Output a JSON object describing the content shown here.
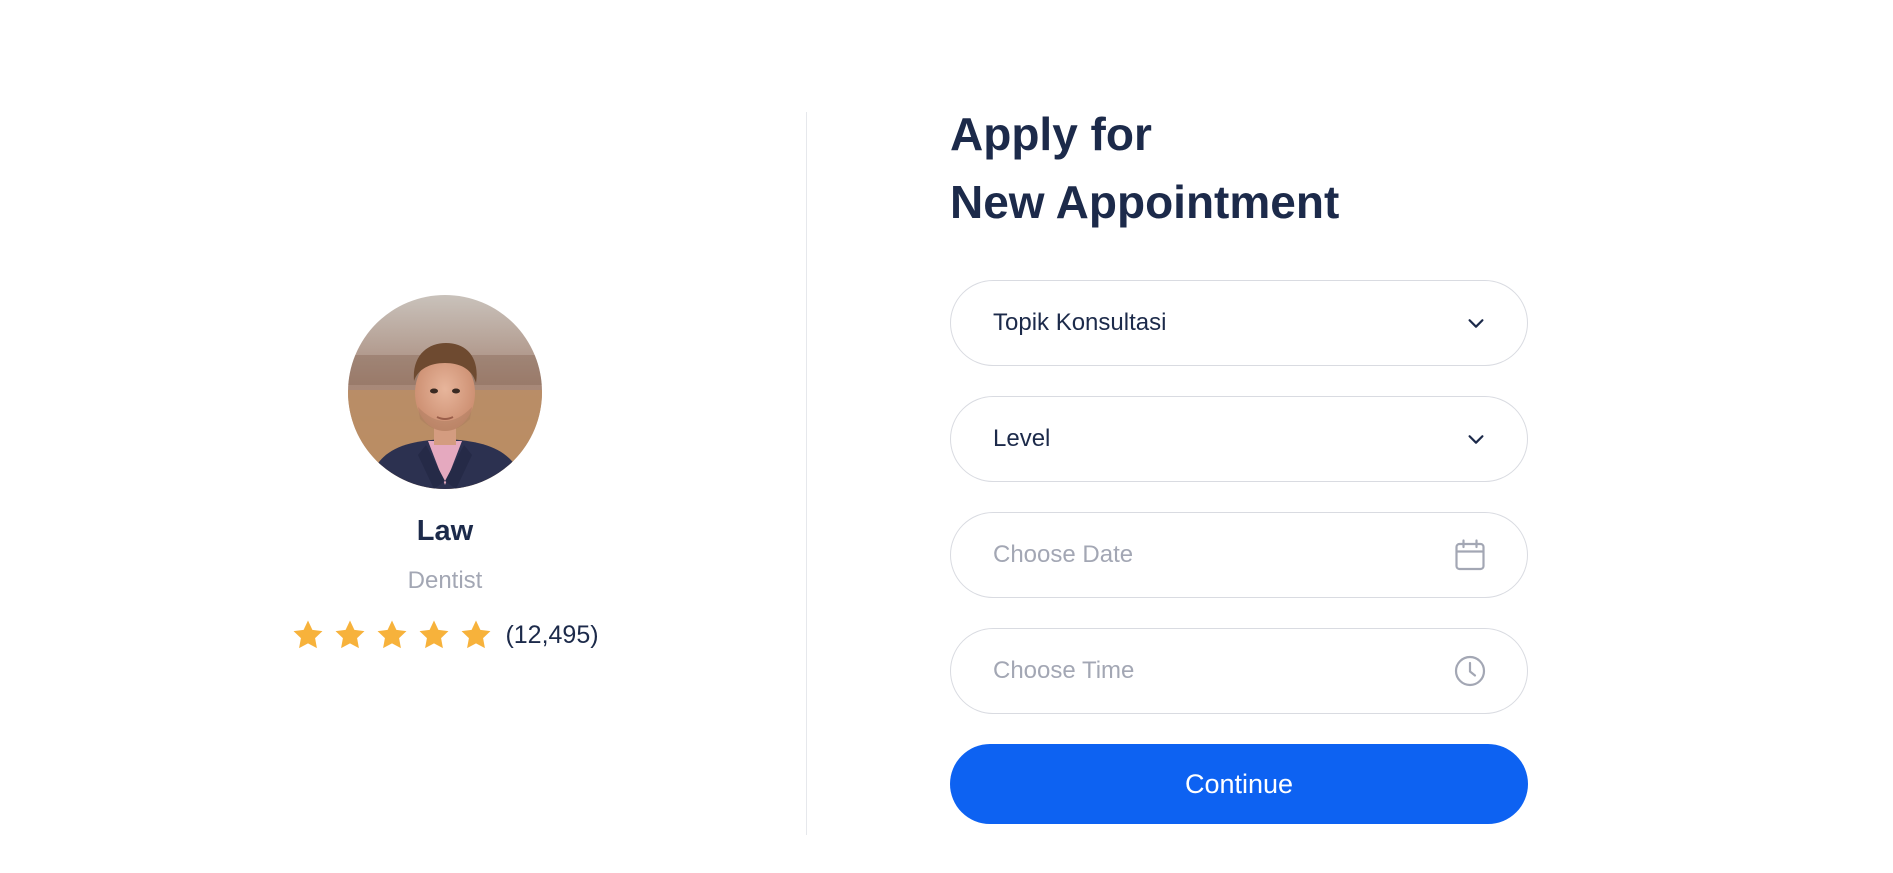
{
  "doctor": {
    "name": "Law",
    "specialty": "Dentist",
    "rating": {
      "stars": 5,
      "max_stars": 5,
      "count_label": "(12,495)"
    },
    "avatar_icon": "doctor-avatar-photo"
  },
  "form": {
    "title_line1": "Apply for",
    "title_line2": "New Appointment",
    "topic_select": {
      "value": "Topik Konsultasi",
      "icon": "chevron-down-icon"
    },
    "level_select": {
      "value": "Level",
      "icon": "chevron-down-icon"
    },
    "date_input": {
      "placeholder": "Choose Date",
      "icon": "calendar-icon"
    },
    "time_input": {
      "placeholder": "Choose Time",
      "icon": "clock-icon"
    },
    "continue_label": "Continue"
  },
  "colors": {
    "heading": "#1c2a4a",
    "muted": "#a3a7b4",
    "accent": "#0d62f2",
    "star": "#f7b23b",
    "border": "#d9dbe1"
  }
}
